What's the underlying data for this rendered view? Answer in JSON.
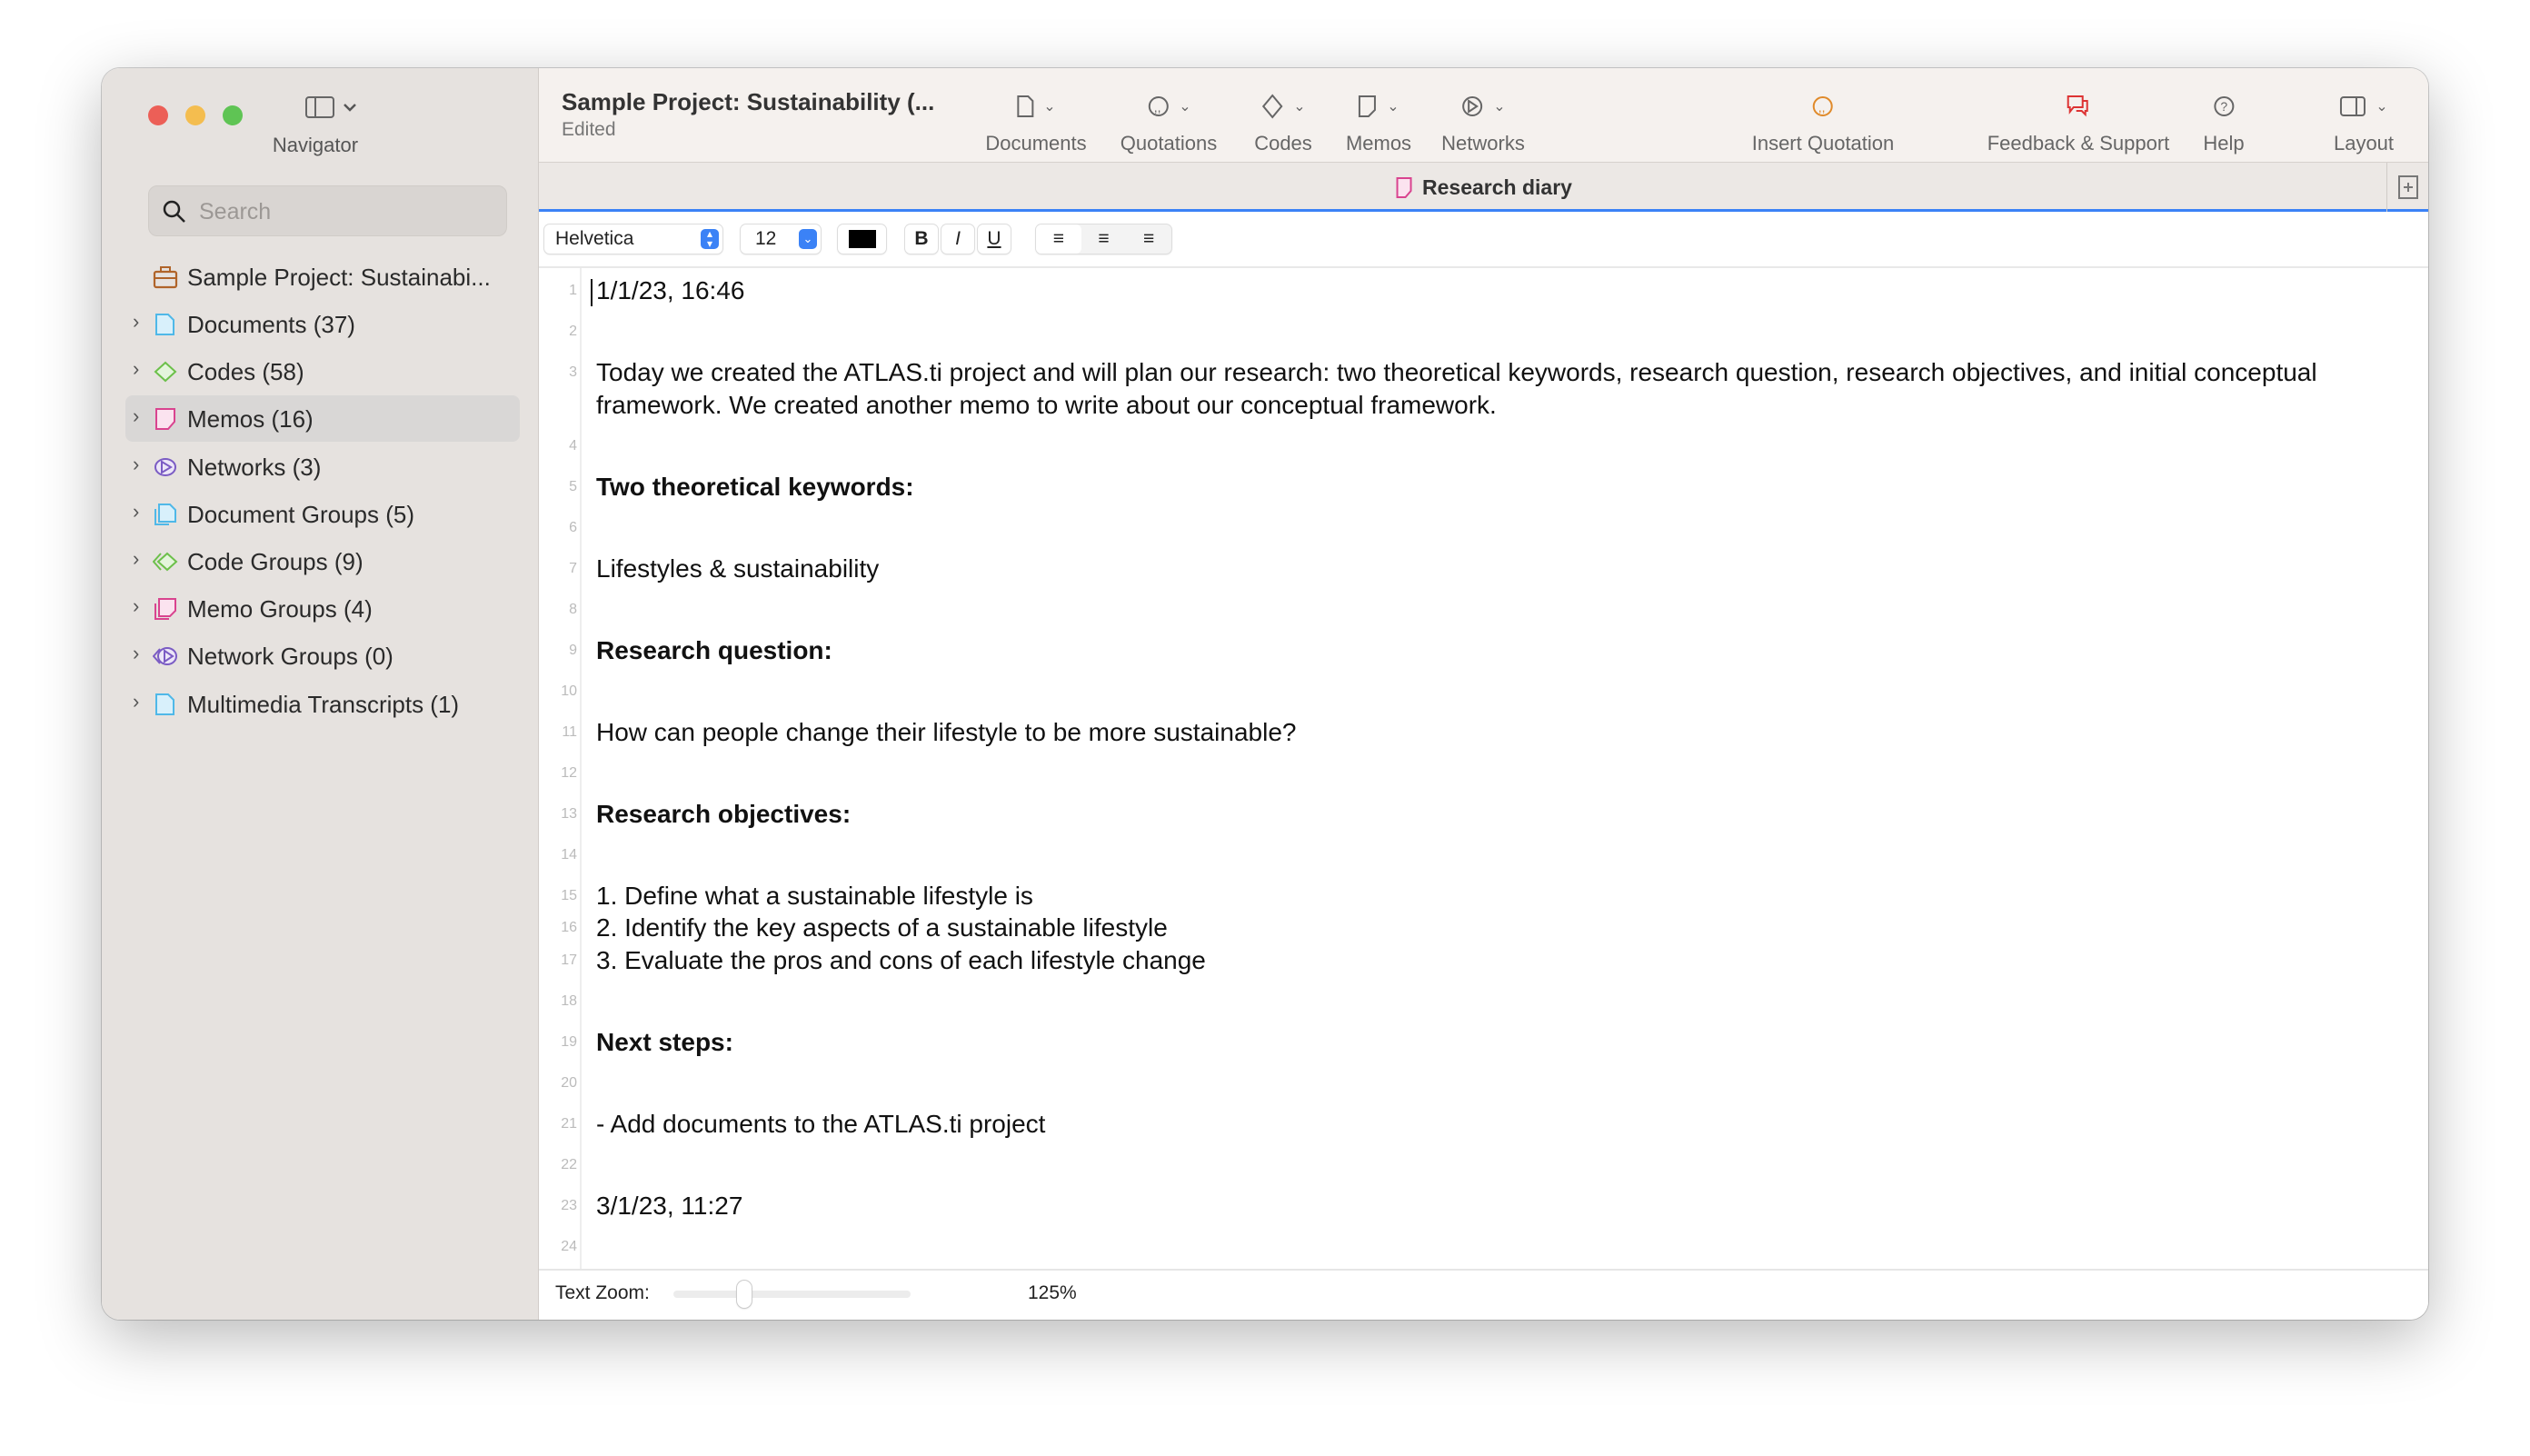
{
  "sidebar": {
    "navigator_label": "Navigator",
    "search_placeholder": "Search",
    "project": "Sample Project: Sustainabi...",
    "items": [
      {
        "label": "Documents (37)",
        "icon": "document-icon",
        "color": "#4fb8e8"
      },
      {
        "label": "Codes (58)",
        "icon": "code-diamond-icon",
        "color": "#6cc04a"
      },
      {
        "label": "Memos (16)",
        "icon": "memo-icon",
        "color": "#d9448f",
        "selected": true
      },
      {
        "label": "Networks (3)",
        "icon": "network-icon",
        "color": "#7b5cc4"
      },
      {
        "label": "Document Groups (5)",
        "icon": "document-group-icon",
        "color": "#4fb8e8"
      },
      {
        "label": "Code Groups (9)",
        "icon": "code-group-icon",
        "color": "#6cc04a"
      },
      {
        "label": "Memo Groups (4)",
        "icon": "memo-group-icon",
        "color": "#d9448f"
      },
      {
        "label": "Network Groups (0)",
        "icon": "network-group-icon",
        "color": "#7b5cc4"
      },
      {
        "label": "Multimedia Transcripts (1)",
        "icon": "transcript-icon",
        "color": "#4fb8e8"
      }
    ]
  },
  "toolbar": {
    "title": "Sample Project: Sustainability (...",
    "status": "Edited",
    "documents": "Documents",
    "quotations": "Quotations",
    "codes": "Codes",
    "memos": "Memos",
    "networks": "Networks",
    "insert_quotation": "Insert Quotation",
    "feedback": "Feedback & Support",
    "help": "Help",
    "layout": "Layout"
  },
  "tab": {
    "title": "Research diary"
  },
  "format": {
    "font": "Helvetica",
    "size": "12",
    "bold": "B",
    "italic": "I",
    "underline": "U",
    "color": "#000000"
  },
  "lines": [
    {
      "n": "1",
      "text": "1/1/23, 16:46"
    },
    {
      "n": "2",
      "text": ""
    },
    {
      "n": "3",
      "text": "Today we created the ATLAS.ti project and will plan our research: two theoretical keywords, research question, research objectives, and initial conceptual framework. We created another memo to write about our conceptual framework."
    },
    {
      "n": "4",
      "text": ""
    },
    {
      "n": "5",
      "text": "Two theoretical keywords:",
      "bold": true
    },
    {
      "n": "6",
      "text": ""
    },
    {
      "n": "7",
      "text": "Lifestyles & sustainability"
    },
    {
      "n": "8",
      "text": ""
    },
    {
      "n": "9",
      "text": "Research question:",
      "bold": true
    },
    {
      "n": "10",
      "text": ""
    },
    {
      "n": "11",
      "text": "How can people change their lifestyle to be more sustainable?"
    },
    {
      "n": "12",
      "text": ""
    },
    {
      "n": "13",
      "text": "Research objectives:",
      "bold": true
    },
    {
      "n": "14",
      "text": ""
    },
    {
      "n": "15",
      "text": "1. Define what a sustainable lifestyle is"
    },
    {
      "n": "16",
      "text": "2. Identify the key aspects of a sustainable lifestyle"
    },
    {
      "n": "17",
      "text": "3. Evaluate the pros and cons of each lifestyle change"
    },
    {
      "n": "18",
      "text": ""
    },
    {
      "n": "19",
      "text": "Next steps:",
      "bold": true
    },
    {
      "n": "20",
      "text": ""
    },
    {
      "n": "21",
      "text": "- Add documents to the ATLAS.ti project"
    },
    {
      "n": "22",
      "text": ""
    },
    {
      "n": "23",
      "text": "3/1/23, 11:27"
    },
    {
      "n": "24",
      "text": ""
    }
  ],
  "footer": {
    "zoom_label": "Text Zoom:",
    "zoom_value": "125%",
    "zoom_level_fraction": 0.3
  }
}
